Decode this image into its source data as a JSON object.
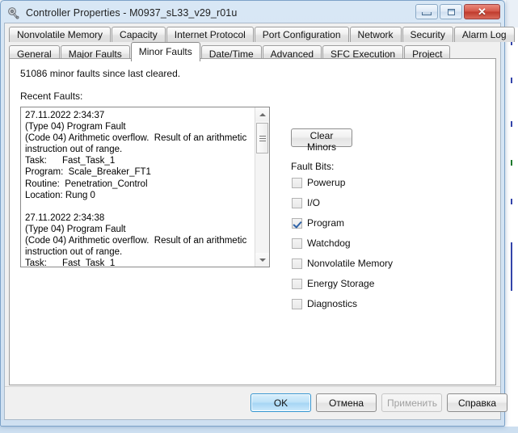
{
  "window": {
    "title": "Controller Properties - M0937_sL33_v29_r01u",
    "icon": "controller-icon",
    "buttons": {
      "minimize": "–",
      "maximize": "□",
      "close": "✕"
    }
  },
  "tabs": {
    "row1": [
      {
        "label": "Nonvolatile Memory",
        "selected": false
      },
      {
        "label": "Capacity",
        "selected": false
      },
      {
        "label": "Internet Protocol",
        "selected": false
      },
      {
        "label": "Port Configuration",
        "selected": false
      },
      {
        "label": "Network",
        "selected": false
      },
      {
        "label": "Security",
        "selected": false
      },
      {
        "label": "Alarm Log",
        "selected": false
      }
    ],
    "row2": [
      {
        "label": "General",
        "selected": false
      },
      {
        "label": "Major Faults",
        "selected": false
      },
      {
        "label": "Minor Faults",
        "selected": true
      },
      {
        "label": "Date/Time",
        "selected": false
      },
      {
        "label": "Advanced",
        "selected": false
      },
      {
        "label": "SFC Execution",
        "selected": false
      },
      {
        "label": "Project",
        "selected": false
      }
    ]
  },
  "page": {
    "summary": "51086 minor faults since last cleared.",
    "recent_label": "Recent Faults:",
    "fault_log": "27.11.2022 2:34:37\n(Type 04) Program Fault\n(Code 04) Arithmetic overflow.  Result of an arithmetic\ninstruction out of range.\nTask:      Fast_Task_1\nProgram:  Scale_Breaker_FT1\nRoutine:  Penetration_Control\nLocation: Rung 0\n\n27.11.2022 2:34:38\n(Type 04) Program Fault\n(Code 04) Arithmetic overflow.  Result of an arithmetic\ninstruction out of range.\nTask:      Fast_Task_1",
    "clear_minors_label": "Clear Minors",
    "fault_bits_label": "Fault Bits:",
    "fault_bits": [
      {
        "label": "Powerup",
        "checked": false
      },
      {
        "label": "I/O",
        "checked": false
      },
      {
        "label": "Program",
        "checked": true
      },
      {
        "label": "Watchdog",
        "checked": false
      },
      {
        "label": "Nonvolatile Memory",
        "checked": false
      },
      {
        "label": "Energy Storage",
        "checked": false
      },
      {
        "label": "Diagnostics",
        "checked": false
      }
    ]
  },
  "footer": {
    "ok": "OK",
    "cancel": "Отмена",
    "apply": "Применить",
    "help": "Справка"
  },
  "colors": {
    "title_bar": "#d3e2f2",
    "accent": "#2f93d0",
    "check": "#2f63a8",
    "close_button": "#c4442f"
  }
}
